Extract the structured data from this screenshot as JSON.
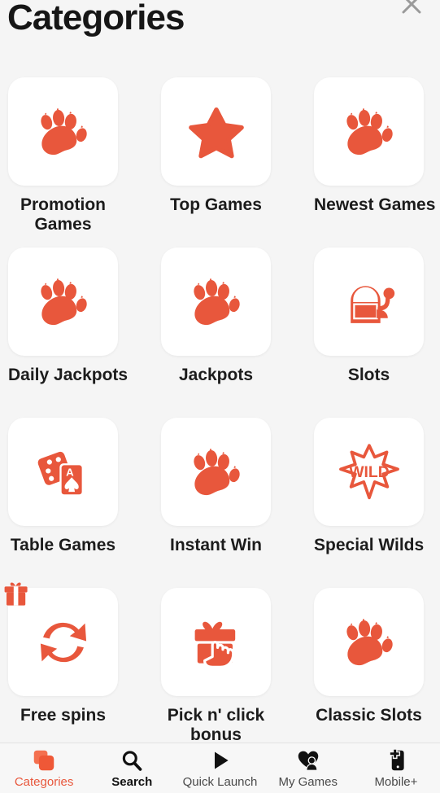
{
  "header": {
    "title": "Categories",
    "close_icon": "close-icon"
  },
  "theme": {
    "accent": "#e8573c",
    "background": "#f5f5f5",
    "tile_background": "#ffffff",
    "label_color": "#1c1c1c",
    "nav_background": "#f7f7f7"
  },
  "grid": {
    "rows": [
      [
        {
          "label": "Promotion Games",
          "icon": "paw-icon",
          "wrap": true
        },
        {
          "label": "Top Games",
          "icon": "star-icon",
          "wrap": false
        },
        {
          "label": "Newest Games",
          "icon": "paw-icon",
          "wrap": false
        }
      ],
      [
        {
          "label": "Daily Jackpots",
          "icon": "paw-icon",
          "wrap": false
        },
        {
          "label": "Jackpots",
          "icon": "paw-icon",
          "wrap": false
        },
        {
          "label": "Slots",
          "icon": "slot-machine-icon",
          "wrap": false
        }
      ],
      [
        {
          "label": "Table Games",
          "icon": "dice-and-card-icon",
          "wrap": false
        },
        {
          "label": "Instant Win",
          "icon": "paw-icon",
          "wrap": false
        },
        {
          "label": "Special Wilds",
          "icon": "wild-burst-icon",
          "wrap": false,
          "burst_text": "WILD"
        }
      ],
      [
        {
          "label": "Free spins",
          "icon": "spin-arrows-icon",
          "wrap": false,
          "badge": "gift-icon"
        },
        {
          "label": "Pick n' click bonus",
          "icon": "gift-click-icon",
          "wrap": true
        },
        {
          "label": "Classic Slots",
          "icon": "paw-icon",
          "wrap": false
        }
      ]
    ]
  },
  "bottom_nav": {
    "items": [
      {
        "label": "Categories",
        "icon": "layers-icon",
        "state": "active"
      },
      {
        "label": "Search",
        "icon": "search-icon",
        "state": "bold"
      },
      {
        "label": "Quick Launch",
        "icon": "play-icon",
        "state": "normal"
      },
      {
        "label": "My Games",
        "icon": "heart-person-icon",
        "state": "normal"
      },
      {
        "label": "Mobile+",
        "icon": "mobile-plus-icon",
        "state": "normal"
      }
    ]
  }
}
